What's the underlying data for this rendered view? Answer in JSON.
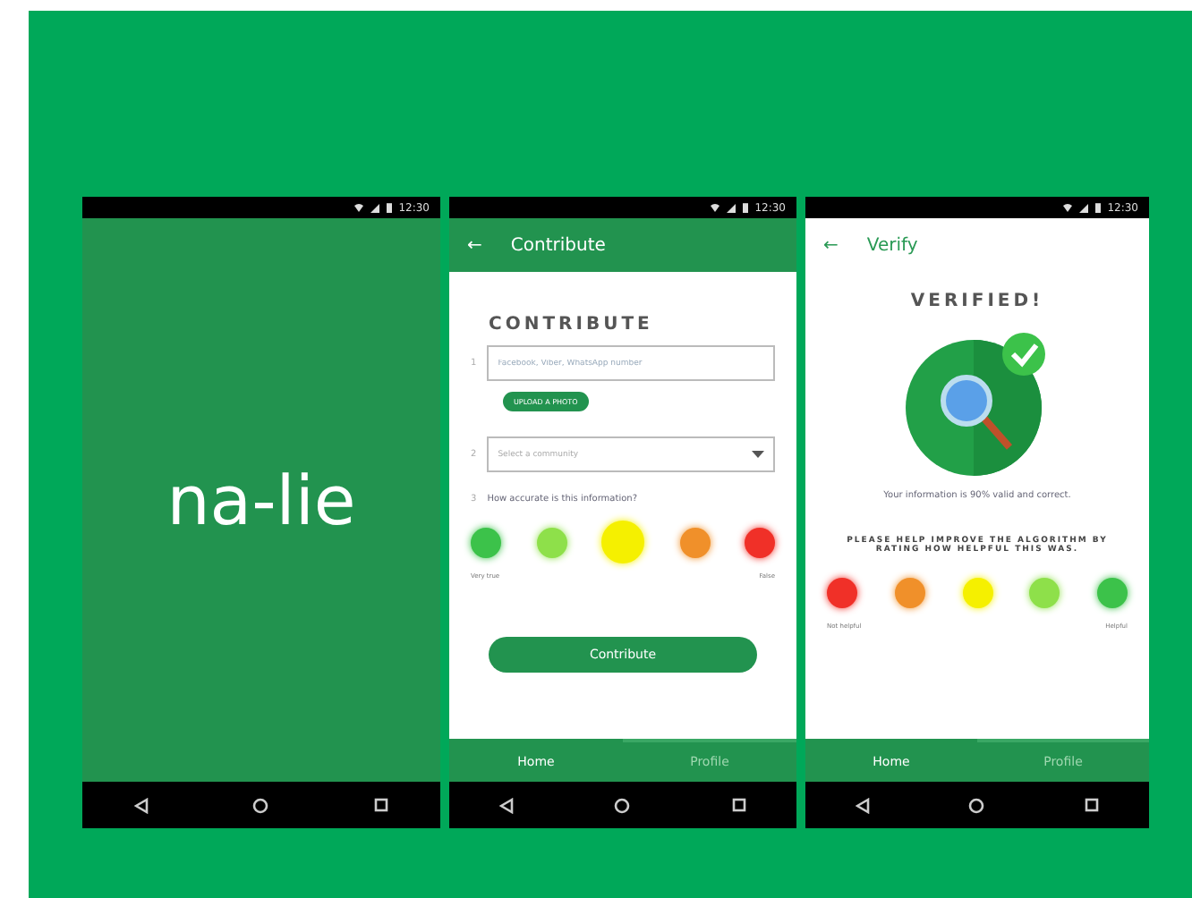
{
  "screens": [
    {
      "kind": "splash",
      "status_time": "12:30",
      "logo": "na-lie"
    },
    {
      "kind": "contribute",
      "status_time": "12:30",
      "app_bar": {
        "back": "←",
        "title": "Contribute",
        "dark": true
      },
      "heading": "CONTRIBUTE",
      "steps": [
        "1",
        "2",
        "3"
      ],
      "field": {
        "placeholder": "Facebook, Viber, WhatsApp number"
      },
      "upload_button": "UPLOAD A PHOTO",
      "dropdown": {
        "placeholder": "Select a community"
      },
      "question": "How accurate is this information?",
      "ratings": [
        {
          "color": "#3cc24a",
          "selected": false
        },
        {
          "color": "#8ee04a",
          "selected": false
        },
        {
          "color": "#f5f000",
          "selected": true
        },
        {
          "color": "#f0902a",
          "selected": false
        },
        {
          "color": "#f03028",
          "selected": false
        }
      ],
      "scale_low": "Very true",
      "scale_high": "False",
      "submit": "Contribute",
      "tabs": [
        {
          "label": "Home",
          "selected": true
        },
        {
          "label": "Profile",
          "selected": false
        }
      ]
    },
    {
      "kind": "verify",
      "status_time": "12:30",
      "app_bar": {
        "back": "←",
        "title": "Verify",
        "dark": false
      },
      "heading": "VERIFIED!",
      "message": "Your information is 90% valid and correct.",
      "prompt": "PLEASE HELP IMPROVE THE ALGORITHM BY RATING HOW HELPFUL THIS WAS.",
      "ratings": [
        {
          "color": "#f03028",
          "selected": false
        },
        {
          "color": "#f0902a",
          "selected": false
        },
        {
          "color": "#f5f000",
          "selected": false
        },
        {
          "color": "#8ee04a",
          "selected": false
        },
        {
          "color": "#3cc24a",
          "selected": false
        }
      ],
      "scale_low": "Not helpful",
      "scale_high": "Helpful",
      "tabs": [
        {
          "label": "Home",
          "selected": true
        },
        {
          "label": "Profile",
          "selected": false
        }
      ]
    }
  ]
}
